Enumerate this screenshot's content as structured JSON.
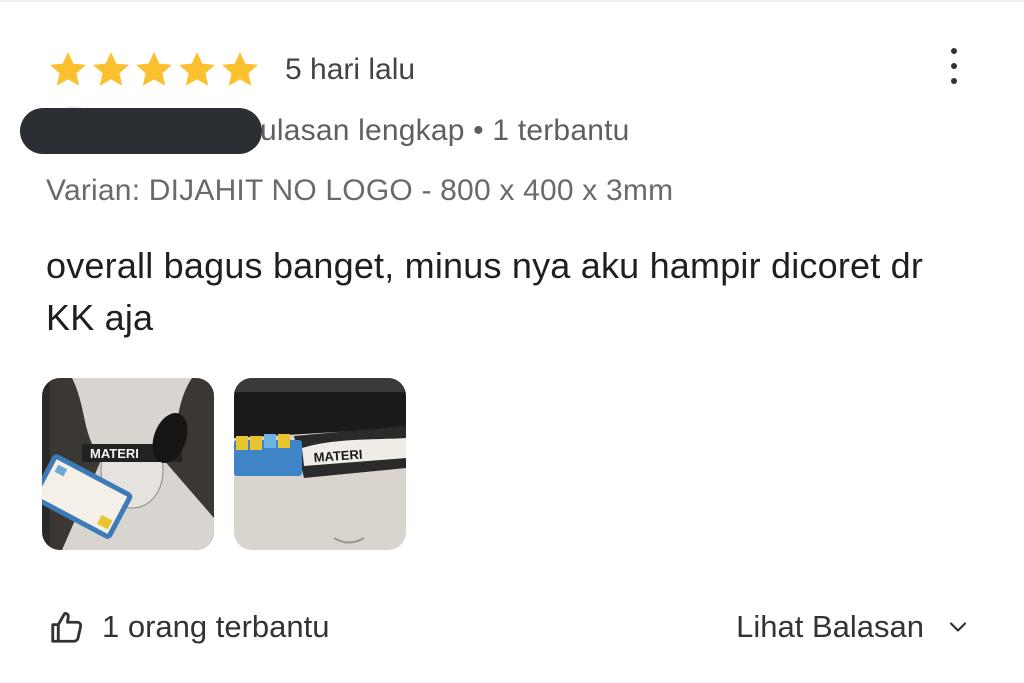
{
  "review": {
    "rating": 5,
    "max_rating": 5,
    "time_ago": "5 hari lalu",
    "star_color": "#fbc02d",
    "user_meta": "ulasan lengkap • 1 terbantu",
    "variant": "Varian: DIJAHIT NO LOGO - 800 x 400 x 3mm",
    "text": "overall bagus banget, minus nya aku hampir dicoret dr KK aja",
    "photos": [
      {
        "icon": "review-photo",
        "overlay_text": "MATERI"
      },
      {
        "icon": "review-photo",
        "overlay_text": "MATERI"
      }
    ]
  },
  "footer": {
    "helpful_icon": "thumbs-up-icon",
    "helpful_label": "1 orang terbantu",
    "replies_label": "Lihat Balasan",
    "replies_icon": "chevron-down-icon"
  },
  "menu": {
    "icon": "more-vertical-icon"
  }
}
